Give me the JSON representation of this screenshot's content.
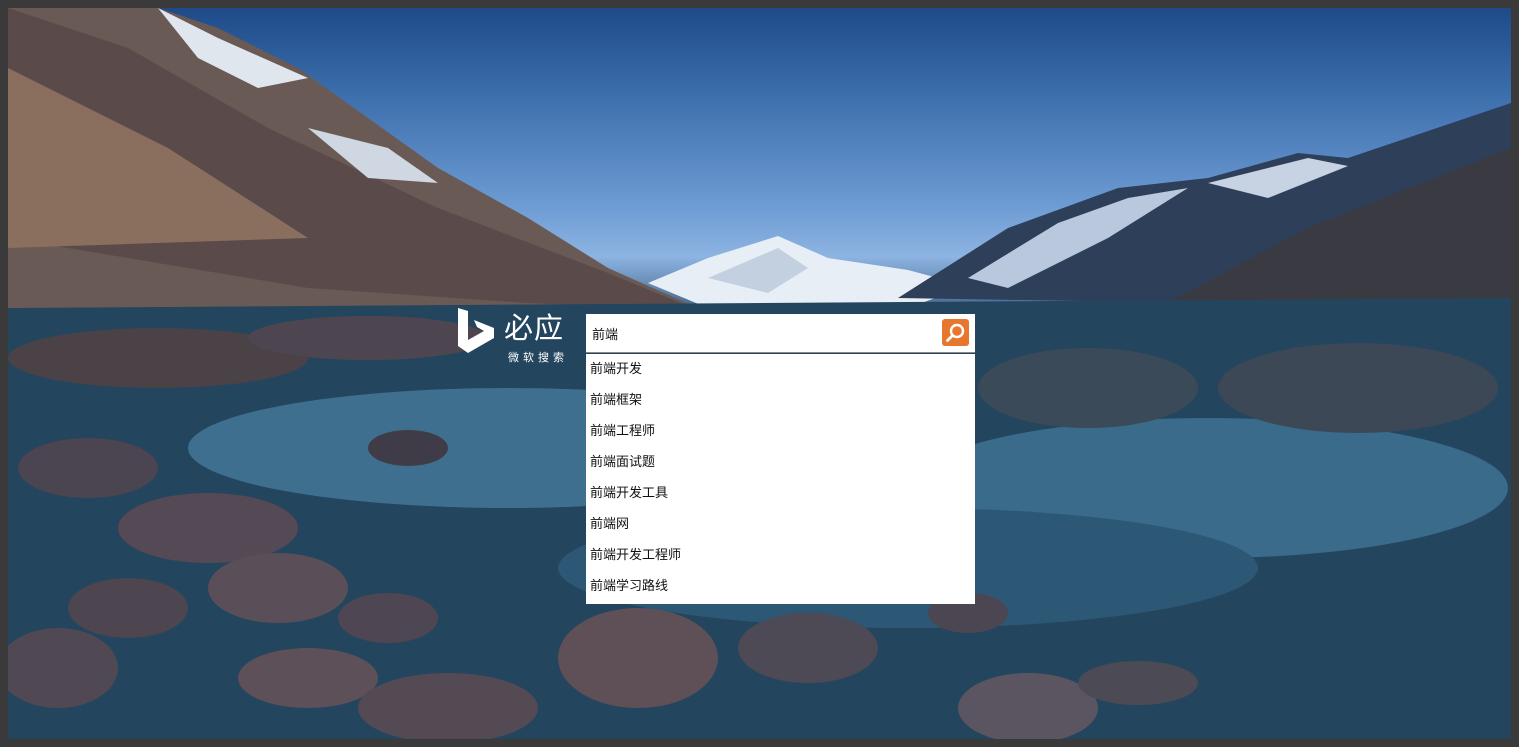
{
  "logo": {
    "title": "必应",
    "subtitle": "微软搜索"
  },
  "search": {
    "value": "前端",
    "button_icon": "search-icon",
    "accent": "#e8772e"
  },
  "suggestions": [
    "前端开发",
    "前端框架",
    "前端工程师",
    "前端面试题",
    "前端开发工具",
    "前端网",
    "前端开发工程师",
    "前端学习路线"
  ]
}
